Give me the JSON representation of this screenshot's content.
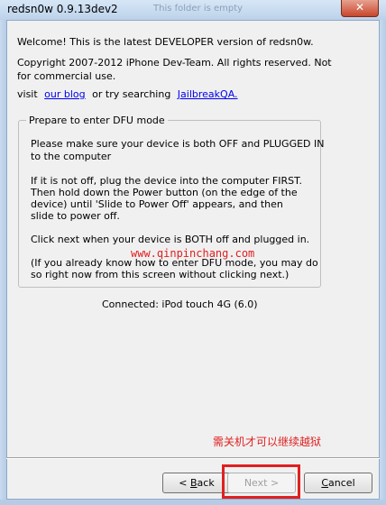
{
  "window": {
    "title": "redsn0w 0.9.13dev2",
    "ghost_title": "This folder is empty",
    "close_glyph": "✕"
  },
  "intro": {
    "welcome": "Welcome!  This is the latest DEVELOPER version of redsn0w.",
    "copyright_line1": "Copyright 2007-2012 iPhone Dev-Team. All rights reserved. Not",
    "copyright_line2": "for commercial use.",
    "visit_prefix": "visit",
    "blog_link": "our blog",
    "search_text": "or try searching",
    "jailbreak_link": "JailbreakQA."
  },
  "dfu_group": {
    "legend": "Prepare to enter DFU mode",
    "p1_line1": "Please make sure your device is both OFF and PLUGGED IN",
    "p1_line2": "to the computer",
    "p2_line1": "If it is not off, plug the device into the computer FIRST.",
    "p2_line2": "Then hold down the Power button (on the edge of the",
    "p2_line3": "device) until 'Slide to Power Off' appears, and then",
    "p2_line4": "slide to power off.",
    "p3": "Click next when your device is BOTH off and plugged in.",
    "p4_line1": "(If you already know how to enter DFU mode, you may do",
    "p4_line2": "so right now from this screen without clicking next.)"
  },
  "status": {
    "connected": "Connected: iPod touch 4G (6.0)"
  },
  "overlay": {
    "watermark": "www.qinpinchang.com",
    "annotation": "需关机才可以继续越狱",
    "annotation_color": "#e02020"
  },
  "buttons": {
    "back_prefix": "< ",
    "back_mnemonic": "B",
    "back_rest": "ack",
    "next_label": "Next >",
    "cancel_mnemonic": "C",
    "cancel_rest": "ancel"
  }
}
